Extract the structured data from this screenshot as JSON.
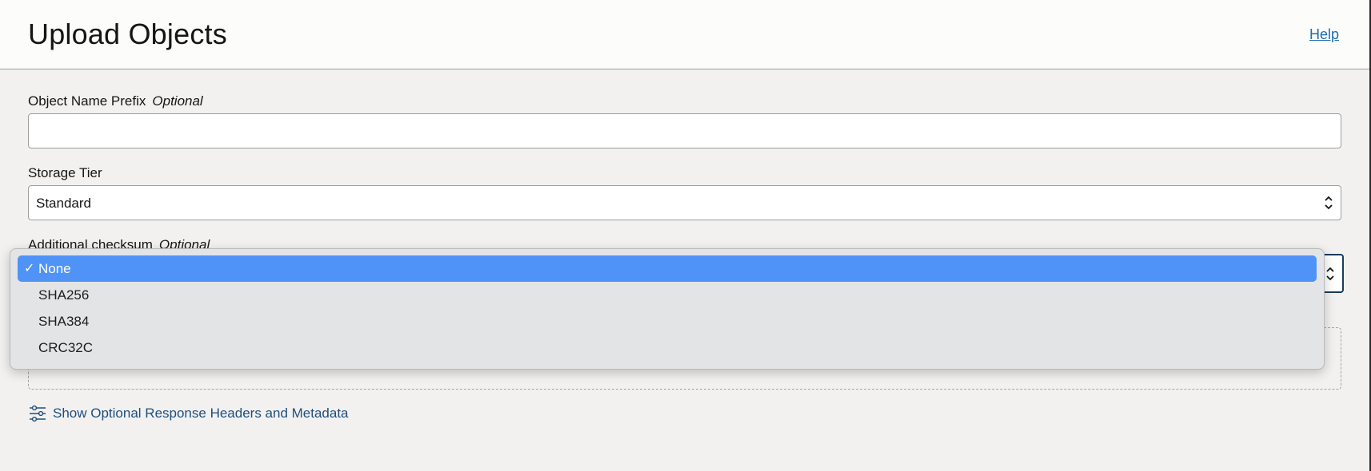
{
  "header": {
    "title": "Upload Objects",
    "help_label": "Help"
  },
  "form": {
    "prefix": {
      "label": "Object Name Prefix",
      "optional": "Optional",
      "value": ""
    },
    "storage_tier": {
      "label": "Storage Tier",
      "selected": "Standard"
    },
    "checksum": {
      "label": "Additional checksum",
      "optional": "Optional",
      "selected": "None",
      "options": [
        "None",
        "SHA256",
        "SHA384",
        "CRC32C"
      ]
    },
    "toggle_label": "Show Optional Response Headers and Metadata"
  },
  "icons": {
    "help": "help-link",
    "select_arrows": "chevron-up-down-icon",
    "check": "checkmark-icon",
    "toggle": "sliders-icon"
  },
  "colors": {
    "accent_link": "#1e6cae",
    "selected_option": "#4f93f7",
    "focus_border": "#1b3b5e"
  }
}
